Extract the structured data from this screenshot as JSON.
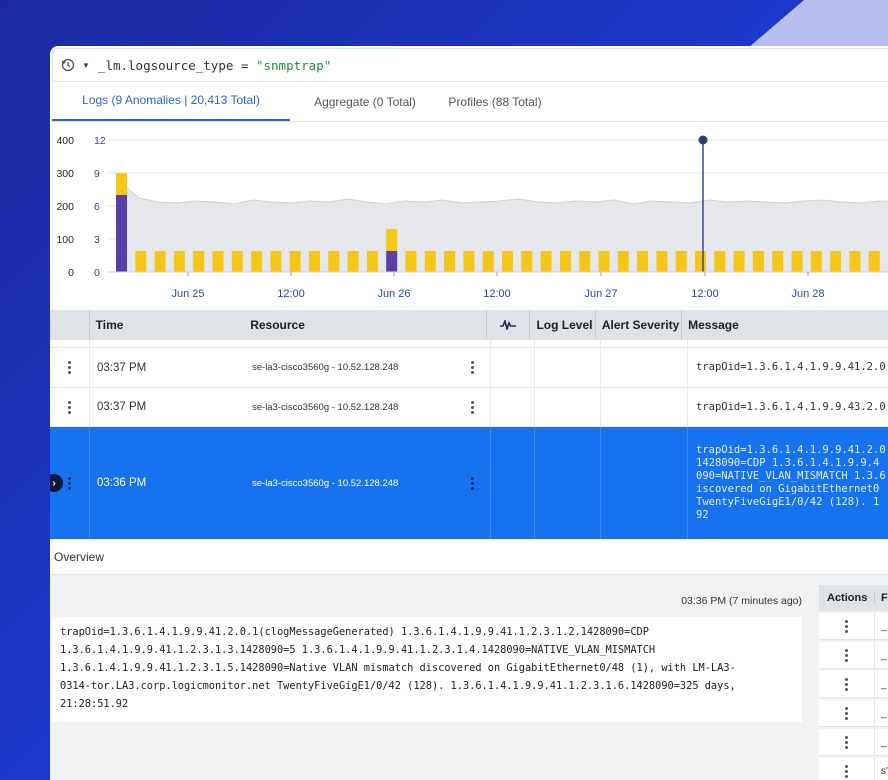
{
  "query": {
    "field": "_lm.logsource_type",
    "operator": "=",
    "value": "\"snmptrap\""
  },
  "tabs": [
    {
      "label": "Logs (9 Anomalies | 20,413 Total)",
      "active": true
    },
    {
      "label": "Aggregate (0 Total)",
      "active": false
    },
    {
      "label": "Profiles (88 Total)",
      "active": false
    }
  ],
  "chart_data": {
    "type": "bar",
    "left_axis_ticks": [
      "400",
      "300",
      "200",
      "100",
      "0"
    ],
    "anomaly_axis_ticks": [
      "12",
      "9",
      "6",
      "3",
      "0"
    ],
    "x_tick_labels": [
      "Jun 25",
      "12:00",
      "Jun 26",
      "12:00",
      "Jun 27",
      "12:00",
      "Jun 28"
    ],
    "colors": {
      "logs": "#f5c518",
      "anomalies": "#5b3fa8",
      "band": "#e6e7ea",
      "marker": "#2b3f7a"
    },
    "anomaly_marker_value": 12
  },
  "table": {
    "columns": [
      "Time",
      "Resource",
      "Log Level",
      "Alert Severity",
      "Message"
    ],
    "rows": [
      {
        "time": "03:37 PM",
        "resource": "se-la3-cisco3560g - 10.52.128.248",
        "message": "trapOid=1.3.6.1.4.1.9.9.41.2.0"
      },
      {
        "time": "03:37 PM",
        "resource": "se-la3-cisco3560g - 10.52.128.248",
        "message": "trapOid=1.3.6.1.4.1.9.9.43.2.0"
      }
    ],
    "selected": {
      "time": "03:36 PM",
      "resource": "se-la3-cisco3560g - 10.52.128.248",
      "message_lines": [
        "trapOid=1.3.6.1.4.1.9.9.41.2.0",
        "1428090=CDP 1.3.6.1.4.1.9.9.4",
        "090=NATIVE_VLAN_MISMATCH 1.3.6",
        "iscovered on GigabitEthernet0",
        "TwentyFiveGigE1/0/42 (128). 1",
        "92"
      ]
    }
  },
  "overview": {
    "title": "Overview",
    "timestamp": "03:36 PM (7 minutes ago)",
    "message_lines": [
      "trapOid=1.3.6.1.4.1.9.9.41.2.0.1(clogMessageGenerated) 1.3.6.1.4.1.9.9.41.1.2.3.1.2.1428090=CDP",
      "1.3.6.1.4.1.9.9.41.1.2.3.1.3.1428090=5 1.3.6.1.4.1.9.9.41.1.2.3.1.4.1428090=NATIVE_VLAN_MISMATCH",
      "1.3.6.1.4.1.9.9.41.1.2.3.1.5.1428090=Native VLAN mismatch discovered on GigabitEthernet0/48 (1), with LM-LA3-",
      "0314-tor.LA3.corp.logicmonitor.net TwentyFiveGigE1/0/42 (128). 1.3.6.1.4.1.9.9.41.1.2.3.1.6.1428090=325 days,",
      "21:28:51.92"
    ],
    "actions_header": "Actions",
    "second_header": "Fi",
    "action_row_values": [
      "_",
      "_",
      "_",
      "_",
      "_",
      "s'"
    ]
  }
}
